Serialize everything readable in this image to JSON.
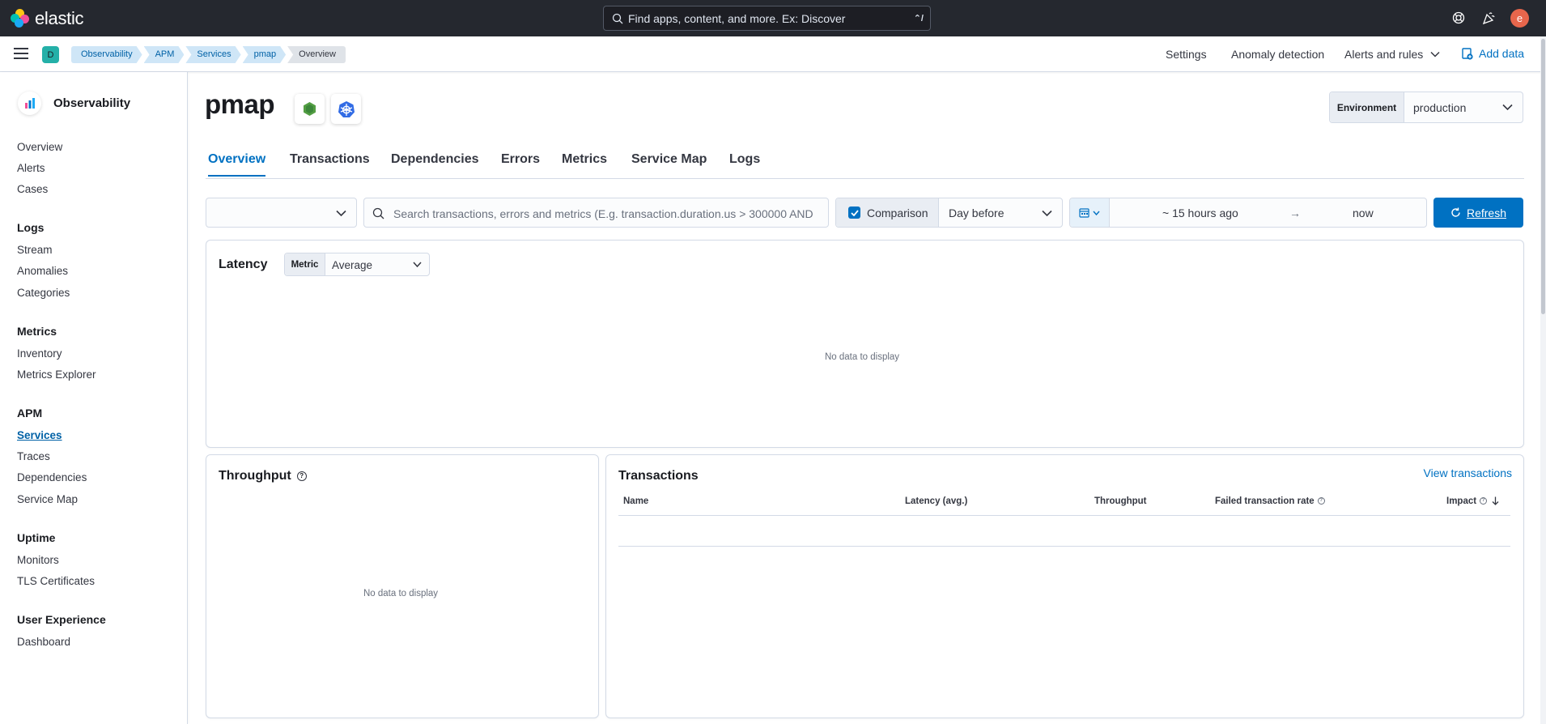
{
  "header": {
    "brand": "elastic",
    "search_placeholder": "Find apps, content, and more. Ex: Discover",
    "search_shortcut": "⌃/",
    "avatar_initial": "e"
  },
  "subheader": {
    "space_initial": "D",
    "breadcrumbs": [
      "Observability",
      "APM",
      "Services",
      "pmap",
      "Overview"
    ],
    "links": {
      "settings": "Settings",
      "anomaly": "Anomaly detection",
      "alerts": "Alerts and rules",
      "add_data": "Add data"
    }
  },
  "sidebar": {
    "title": "Observability",
    "items": [
      "Overview",
      "Alerts",
      "Cases"
    ],
    "sections": [
      {
        "title": "Logs",
        "items": [
          "Stream",
          "Anomalies",
          "Categories"
        ]
      },
      {
        "title": "Metrics",
        "items": [
          "Inventory",
          "Metrics Explorer"
        ]
      },
      {
        "title": "APM",
        "items": [
          "Services",
          "Traces",
          "Dependencies",
          "Service Map"
        ]
      },
      {
        "title": "Uptime",
        "items": [
          "Monitors",
          "TLS Certificates"
        ]
      },
      {
        "title": "User Experience",
        "items": [
          "Dashboard"
        ]
      }
    ],
    "active_item": "Services"
  },
  "page": {
    "title": "pmap",
    "environment_label": "Environment",
    "environment_value": "production",
    "tabs": [
      "Overview",
      "Transactions",
      "Dependencies",
      "Errors",
      "Metrics",
      "Service Map",
      "Logs"
    ],
    "active_tab": "Overview"
  },
  "filters": {
    "type_value": "",
    "search_placeholder": "Search transactions, errors and metrics (E.g. transaction.duration.us > 300000 AND",
    "comparison_label": "Comparison",
    "comparison_checked": true,
    "comparison_value": "Day before",
    "date_start": "~ 15 hours ago",
    "date_arrow": "→",
    "date_end": "now",
    "refresh_label": "Refresh"
  },
  "latency": {
    "title": "Latency",
    "metric_label": "Metric",
    "metric_value": "Average",
    "empty": "No data to display"
  },
  "throughput": {
    "title": "Throughput",
    "empty": "No data to display"
  },
  "transactions": {
    "title": "Transactions",
    "link": "View transactions",
    "columns": [
      "Name",
      "Latency (avg.)",
      "Throughput",
      "Failed transaction rate",
      "Impact"
    ]
  },
  "colors": {
    "header_bg": "#25282f",
    "accent": "#0071c2",
    "space_badge": "#24b0a8",
    "avatar": "#e7664c"
  }
}
